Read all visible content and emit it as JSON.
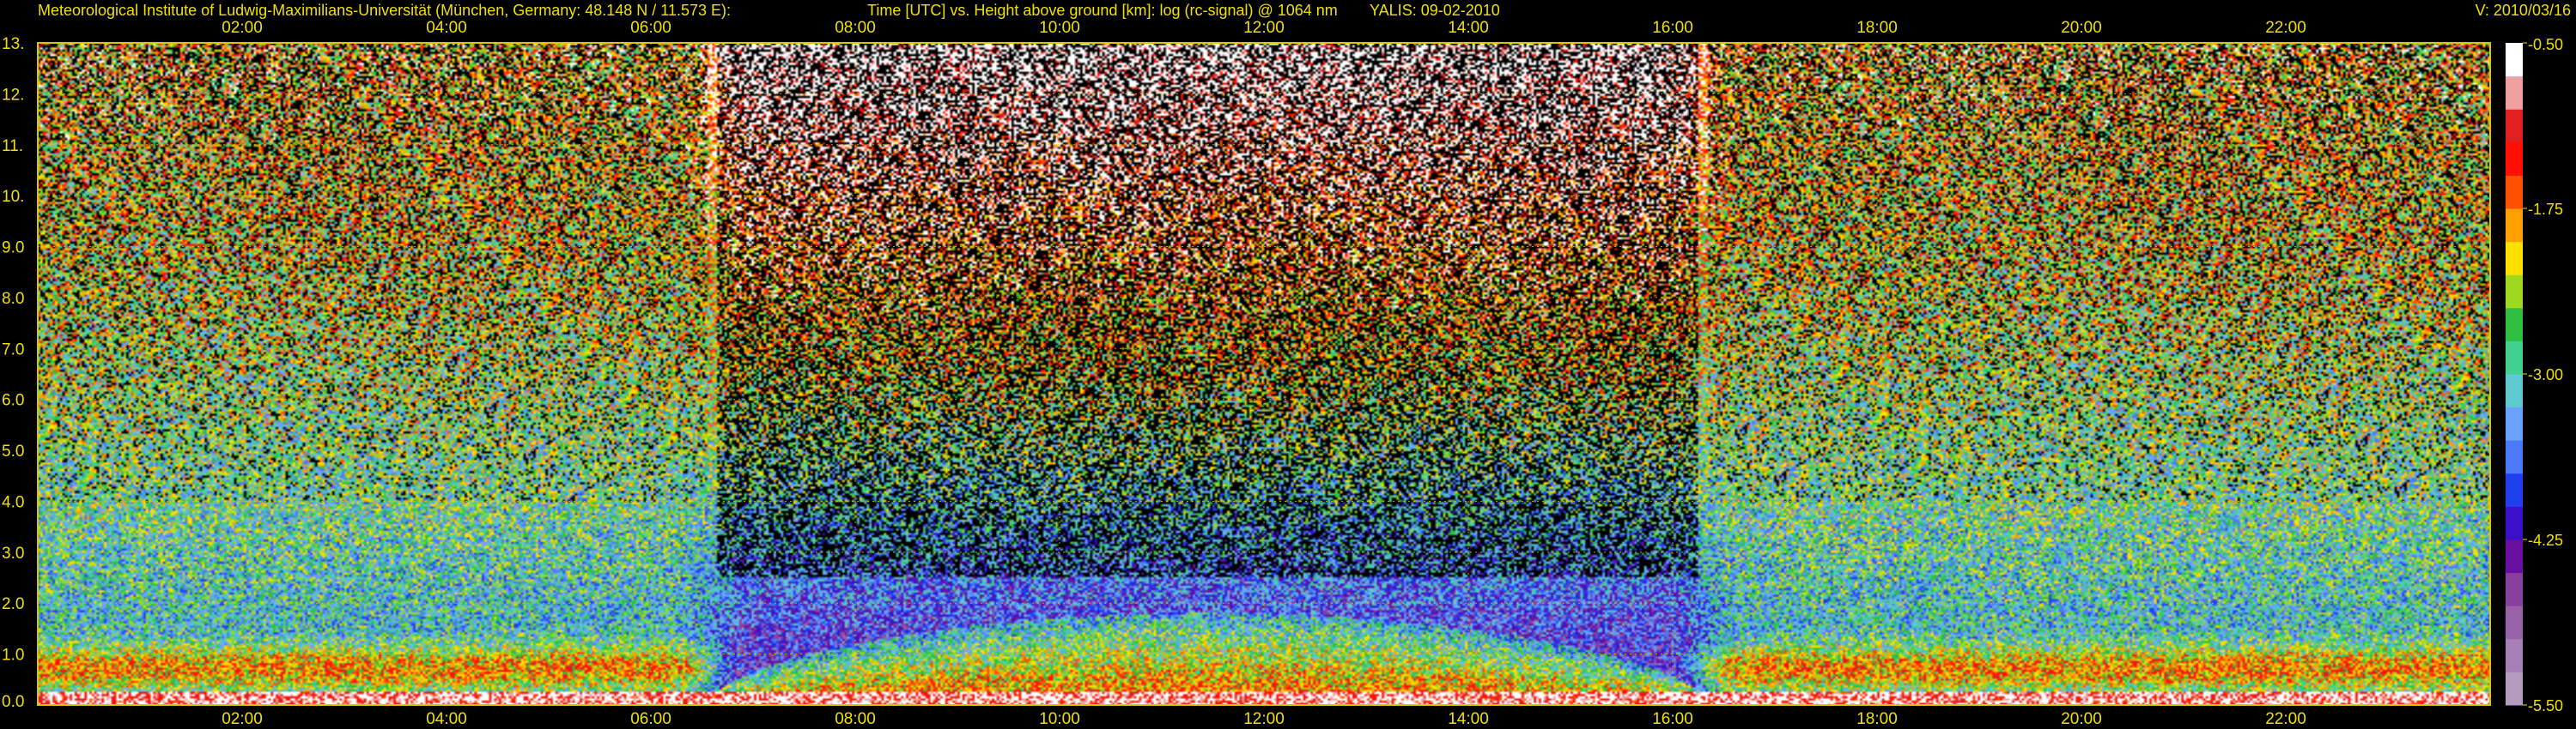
{
  "header": {
    "institute": "Meteorological Institute of Ludwig-Maximilians-Universität (München, Germany: 48.148 N / 11.573 E):",
    "title": "Time [UTC] vs. Height above ground [km]: log (rc-signal) @ 1064 nm",
    "instrument_date": "YALIS: 09-02-2010",
    "version": "V: 2010/03/16"
  },
  "colors": {
    "text": "#f0e000",
    "grid": "#d8c800",
    "background": "#000000"
  },
  "chart_data": {
    "type": "heatmap",
    "title": "Time [UTC] vs. Height above ground [km]: log (rc-signal) @ 1064 nm",
    "x_ticks": [
      "02:00",
      "04:00",
      "06:00",
      "08:00",
      "10:00",
      "12:00",
      "14:00",
      "16:00",
      "18:00",
      "20:00",
      "22:00"
    ],
    "x_tick_hours": [
      2,
      4,
      6,
      8,
      10,
      12,
      14,
      16,
      18,
      20,
      22
    ],
    "xlim_hours": [
      0,
      24
    ],
    "y_ticks": [
      "0.0",
      "1.0",
      "2.0",
      "3.0",
      "4.0",
      "5.0",
      "6.0",
      "7.0",
      "8.0",
      "9.0",
      "10.",
      "11.",
      "12.",
      "13."
    ],
    "y_tick_values": [
      0,
      1,
      2,
      3,
      4,
      5,
      6,
      7,
      8,
      9,
      10,
      11,
      12,
      13
    ],
    "ylim_km": [
      0,
      13
    ],
    "colorbar": {
      "ticks": [
        "-0.50",
        "-1.75",
        "-3.00",
        "-4.25",
        "-5.50"
      ],
      "tick_values": [
        -0.5,
        -1.75,
        -3.0,
        -4.25,
        -5.5
      ],
      "range": [
        -5.5,
        -0.5
      ],
      "colors": [
        "#b49cc0",
        "#a880b8",
        "#9a60a8",
        "#8a40a0",
        "#6a10a0",
        "#3a10c8",
        "#2040f0",
        "#4a7af8",
        "#6aa0ff",
        "#60c8d0",
        "#40d090",
        "#30c040",
        "#a0d820",
        "#ffe000",
        "#ffa000",
        "#ff5000",
        "#ff1000",
        "#e02020",
        "#f0a0a0",
        "#ffffff"
      ]
    },
    "grid": true,
    "features": {
      "daytime_background_hours": [
        6.6,
        16.3
      ],
      "boundary_layer_top_km": 1.8,
      "boundary_layer_hours": [
        6.6,
        16.3
      ],
      "nighttime_residual_layer_km": [
        0.3,
        1.1
      ]
    }
  }
}
